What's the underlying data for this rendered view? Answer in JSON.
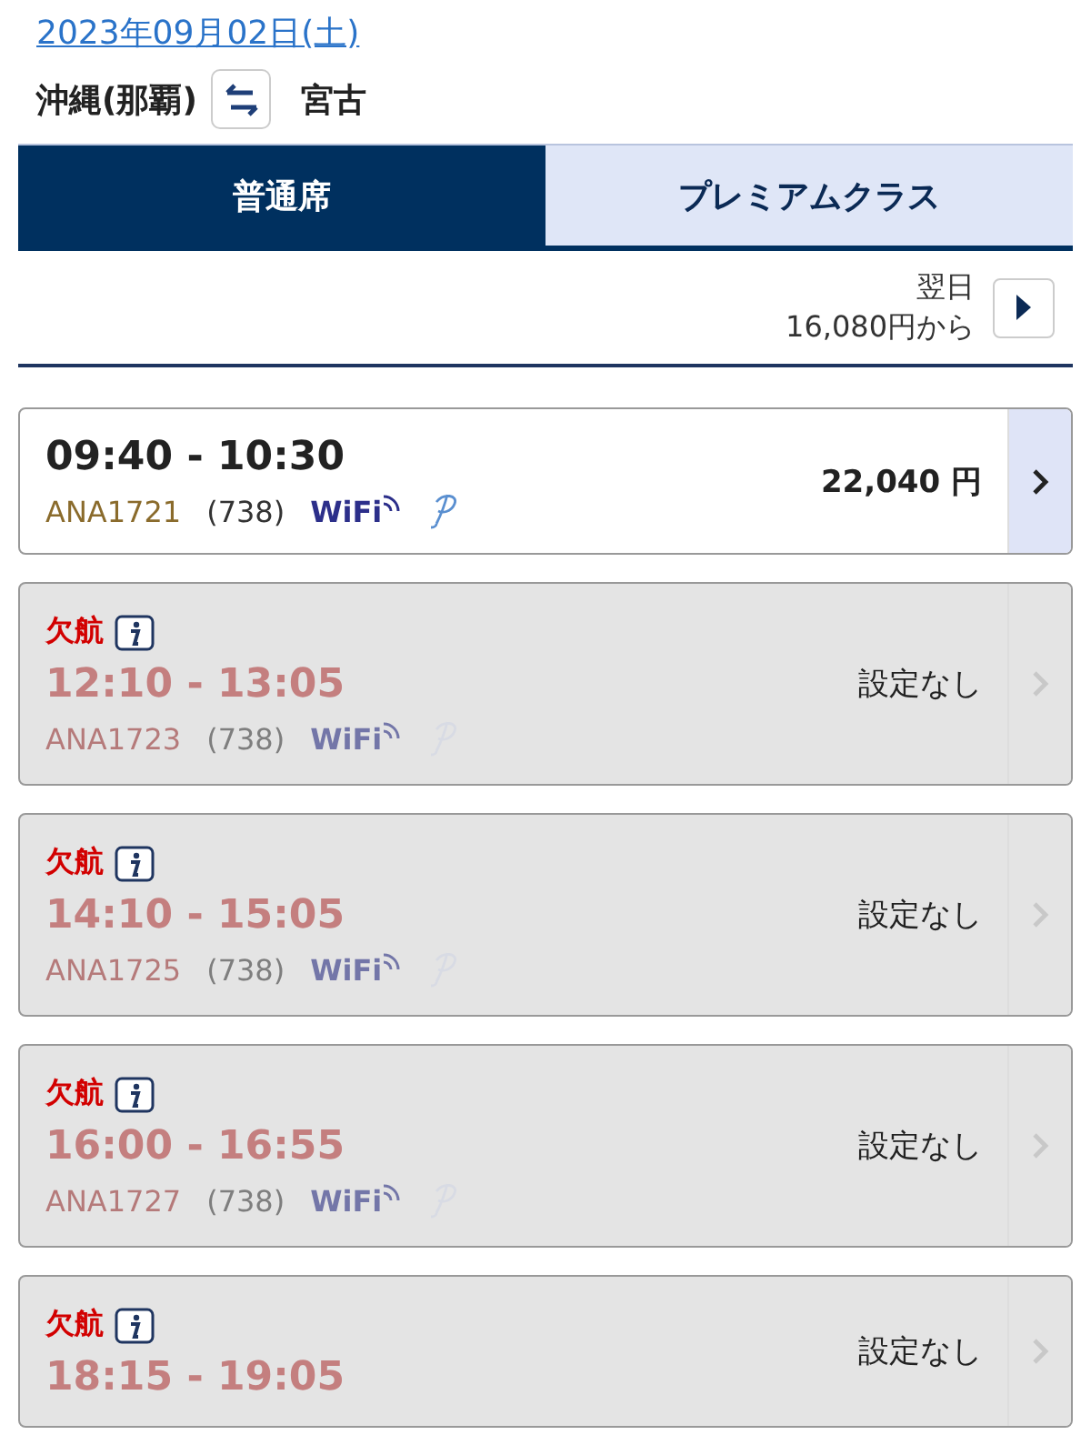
{
  "date": "2023年09月02日(土)",
  "route": {
    "origin": "沖縄(那覇)",
    "destination": "宮古"
  },
  "tabs": [
    {
      "label": "普通席",
      "selected": true
    },
    {
      "label": "プレミアムクラス",
      "selected": false
    }
  ],
  "next_day": {
    "label": "翌日",
    "price": "16,080円から"
  },
  "flights": [
    {
      "kind": "available",
      "time": "09:40 - 10:30",
      "flight": "ANA1721",
      "aircraft": "(738)",
      "wifi": "WiFi",
      "price": "22,040 円"
    },
    {
      "kind": "cancelled",
      "status": "欠航",
      "time": "12:10 - 13:05",
      "flight": "ANA1723",
      "aircraft": "(738)",
      "wifi": "WiFi",
      "price": "設定なし"
    },
    {
      "kind": "cancelled",
      "status": "欠航",
      "time": "14:10 - 15:05",
      "flight": "ANA1725",
      "aircraft": "(738)",
      "wifi": "WiFi",
      "price": "設定なし"
    },
    {
      "kind": "cancelled",
      "status": "欠航",
      "time": "16:00 - 16:55",
      "flight": "ANA1727",
      "aircraft": "(738)",
      "wifi": "WiFi",
      "price": "設定なし"
    },
    {
      "kind": "cancelled",
      "status": "欠航",
      "time": "18:15 - 19:05",
      "price": "設定なし"
    }
  ]
}
